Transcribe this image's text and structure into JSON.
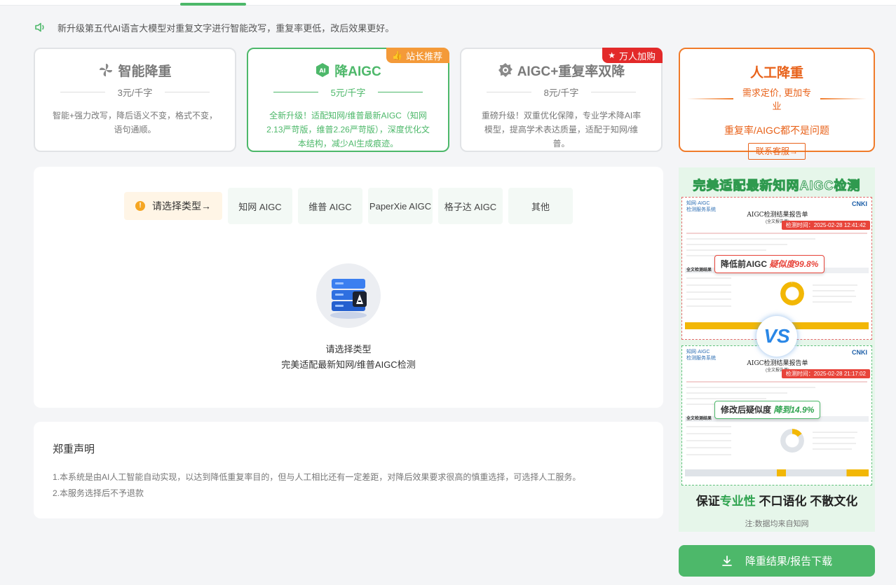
{
  "notice": {
    "text": "新升级第五代AI语言大模型对重复文字进行智能改写，重复率更低，改后效果更好。"
  },
  "modes": [
    {
      "title": "智能降重",
      "price": "3元/千字",
      "desc": "智能+强力改写，降后语义不变，格式不变，语句通顺。",
      "icon": "pinwheel-icon"
    },
    {
      "title": "降AIGC",
      "price": "5元/千字",
      "desc": "全新升级！适配知网/维普最新AIGC（知网2.13严苛版，维普2.26严苛版），深度优化文本结构，减少AI生成痕迹。",
      "badge": "站长推荐",
      "icon": "ai-hexagon-icon",
      "badge_icon": "thumbs-up-icon"
    },
    {
      "title": "AIGC+重复率双降",
      "price": "8元/千字",
      "desc": "重磅升级！双重优化保障，专业学术降AI率模型，提高学术表达质量，适配于知网/维普。",
      "badge": "万人加购",
      "icon": "gear-icon",
      "badge_icon": "star-icon"
    }
  ],
  "manual": {
    "title": "人工降重",
    "tagline": "需求定价, 更加专业",
    "sub": "重复率/AIGC都不是问题",
    "contact": "联系客服→"
  },
  "type_select": {
    "prompt": "请选择类型→",
    "options": [
      "知网 AIGC",
      "维普 AIGC",
      "PaperXie AIGC",
      "格子达 AIGC",
      "其他"
    ]
  },
  "empty_state": {
    "title": "请选择类型",
    "subtitle": "完美适配最新知网/维普AIGC检测"
  },
  "declaration": {
    "title": "郑重声明",
    "lines": [
      "1.本系统是由AI人工智能自动实现，以达到降低重复率目的，但与人工相比还有一定差距，对降后效果要求很高的慎重选择，可选择人工服务。",
      "2.本服务选择后不予退款"
    ]
  },
  "ad": {
    "headline": "完美适配最新知网AIGC检测",
    "report_title": "AIGC检测结果报告单",
    "report_sub": "(全文报告单)",
    "before_time": "检测时间：2025-02-28 12:41:42",
    "after_time": "检测时间：2025-02-28 21:17:02",
    "before_label": "降低前AIGC",
    "before_value": "疑似度99.8%",
    "after_label": "修改后疑似度",
    "after_value": "降到14.9%",
    "section_label": "全文检测结果",
    "vs": "VS",
    "slogan_a": "保证",
    "slogan_b": "专业性",
    "slogan_c": " 不口语化 不散文化",
    "note": "注:数据均来自知网",
    "before_fraction": 0.998,
    "after_fraction": 0.149
  },
  "download_button": "降重结果/报告下载",
  "colors": {
    "accent": "#4db86a",
    "manual": "#e8621a",
    "badge_orange": "#f49a39",
    "badge_red": "#e32a2a"
  }
}
